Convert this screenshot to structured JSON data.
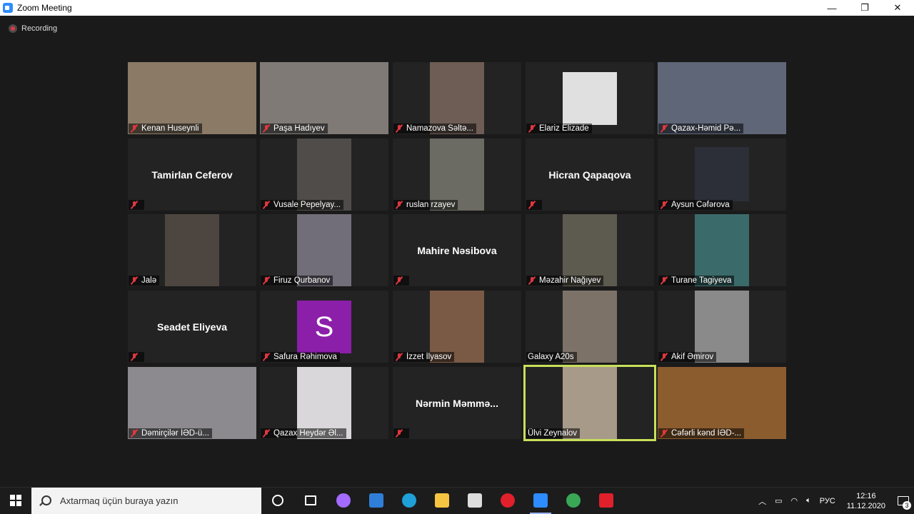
{
  "window": {
    "title": "Zoom Meeting",
    "minimize": "—",
    "maximize": "❐",
    "close": "✕"
  },
  "recording": {
    "label": "Recording"
  },
  "participants": [
    {
      "name": "Kenan Huseynli",
      "muted": true,
      "video": "#8a7a66"
    },
    {
      "name": "Paşa Hadıyev",
      "muted": true,
      "video": "#7f7a75"
    },
    {
      "name": "Namazova Səltə...",
      "muted": true,
      "video": "#6d5d55"
    },
    {
      "name": "Elariz Elizade",
      "muted": true,
      "video": "#e0e0e0"
    },
    {
      "name": "Qazax-Həmid Pə...",
      "muted": true,
      "video": "#5e6678"
    },
    {
      "name": "Tamirlan Ceferov",
      "muted": true,
      "video": null
    },
    {
      "name": "Vusale Pepelyay...",
      "muted": true,
      "video": "#4f4c4a"
    },
    {
      "name": "ruslan rzayev",
      "muted": true,
      "video": "#6b6a63"
    },
    {
      "name": "Hicran Qapaqova",
      "muted": true,
      "video": null
    },
    {
      "name": "Aysun Cəfərova",
      "muted": true,
      "video": "#2c2f38"
    },
    {
      "name": "Jalə",
      "muted": true,
      "video": "#4d4640"
    },
    {
      "name": "Firuz Qurbanov",
      "muted": true,
      "video": "#716e7a"
    },
    {
      "name": "Mahire Nəsibova",
      "muted": true,
      "video": null
    },
    {
      "name": "Məzahir Nağıyev",
      "muted": true,
      "video": "#5d5a4f"
    },
    {
      "name": "Turane Tagiyeva",
      "muted": true,
      "video": "#3b6a6a"
    },
    {
      "name": "Seadet Eliyeva",
      "muted": true,
      "video": null
    },
    {
      "name": "Safura Rəhimova",
      "muted": true,
      "video": "#8b1fa9",
      "avatar_letter": "S"
    },
    {
      "name": "İzzet İlyasov",
      "muted": true,
      "video": "#7a5a45"
    },
    {
      "name": "Galaxy A20s",
      "muted": false,
      "video": "#7d7268"
    },
    {
      "name": "Akif Əmirov",
      "muted": true,
      "video": "#8a8a8a"
    },
    {
      "name": "Dəmirçilər İƏD-ü...",
      "muted": true,
      "video": "#8c8a8f"
    },
    {
      "name": "Qazax Heydər Əl...",
      "muted": true,
      "video": "#d9d7da"
    },
    {
      "name": "Nərmin  Məmmə...",
      "muted": true,
      "video": null
    },
    {
      "name": "Ülvi Zeynalov",
      "muted": false,
      "video": "#a89a88",
      "active": true
    },
    {
      "name": "Cəfərli kənd İƏD-...",
      "muted": true,
      "video": "#8b5c2e"
    }
  ],
  "taskbar": {
    "search_placeholder": "Axtarmaq üçün buraya yazın",
    "apps": [
      {
        "icon": "cortana-icon",
        "color": "#ffffff"
      },
      {
        "icon": "task-view-icon",
        "color": "#ffffff"
      },
      {
        "icon": "assistant-icon",
        "color": "#a36bff"
      },
      {
        "icon": "mail-icon",
        "color": "#2f7fd8"
      },
      {
        "icon": "edge-icon",
        "color": "#1fa0d8"
      },
      {
        "icon": "file-explorer-icon",
        "color": "#f5c542"
      },
      {
        "icon": "store-icon",
        "color": "#dddddd"
      },
      {
        "icon": "opera-icon",
        "color": "#e0202b"
      },
      {
        "icon": "zoom-icon",
        "color": "#2d8cff"
      },
      {
        "icon": "chrome-icon",
        "color": "#3aa757"
      },
      {
        "icon": "yandex-icon",
        "color": "#e0202b"
      }
    ],
    "language": "РУС",
    "time": "12:16",
    "date": "11.12.2020",
    "notifications": "3"
  }
}
